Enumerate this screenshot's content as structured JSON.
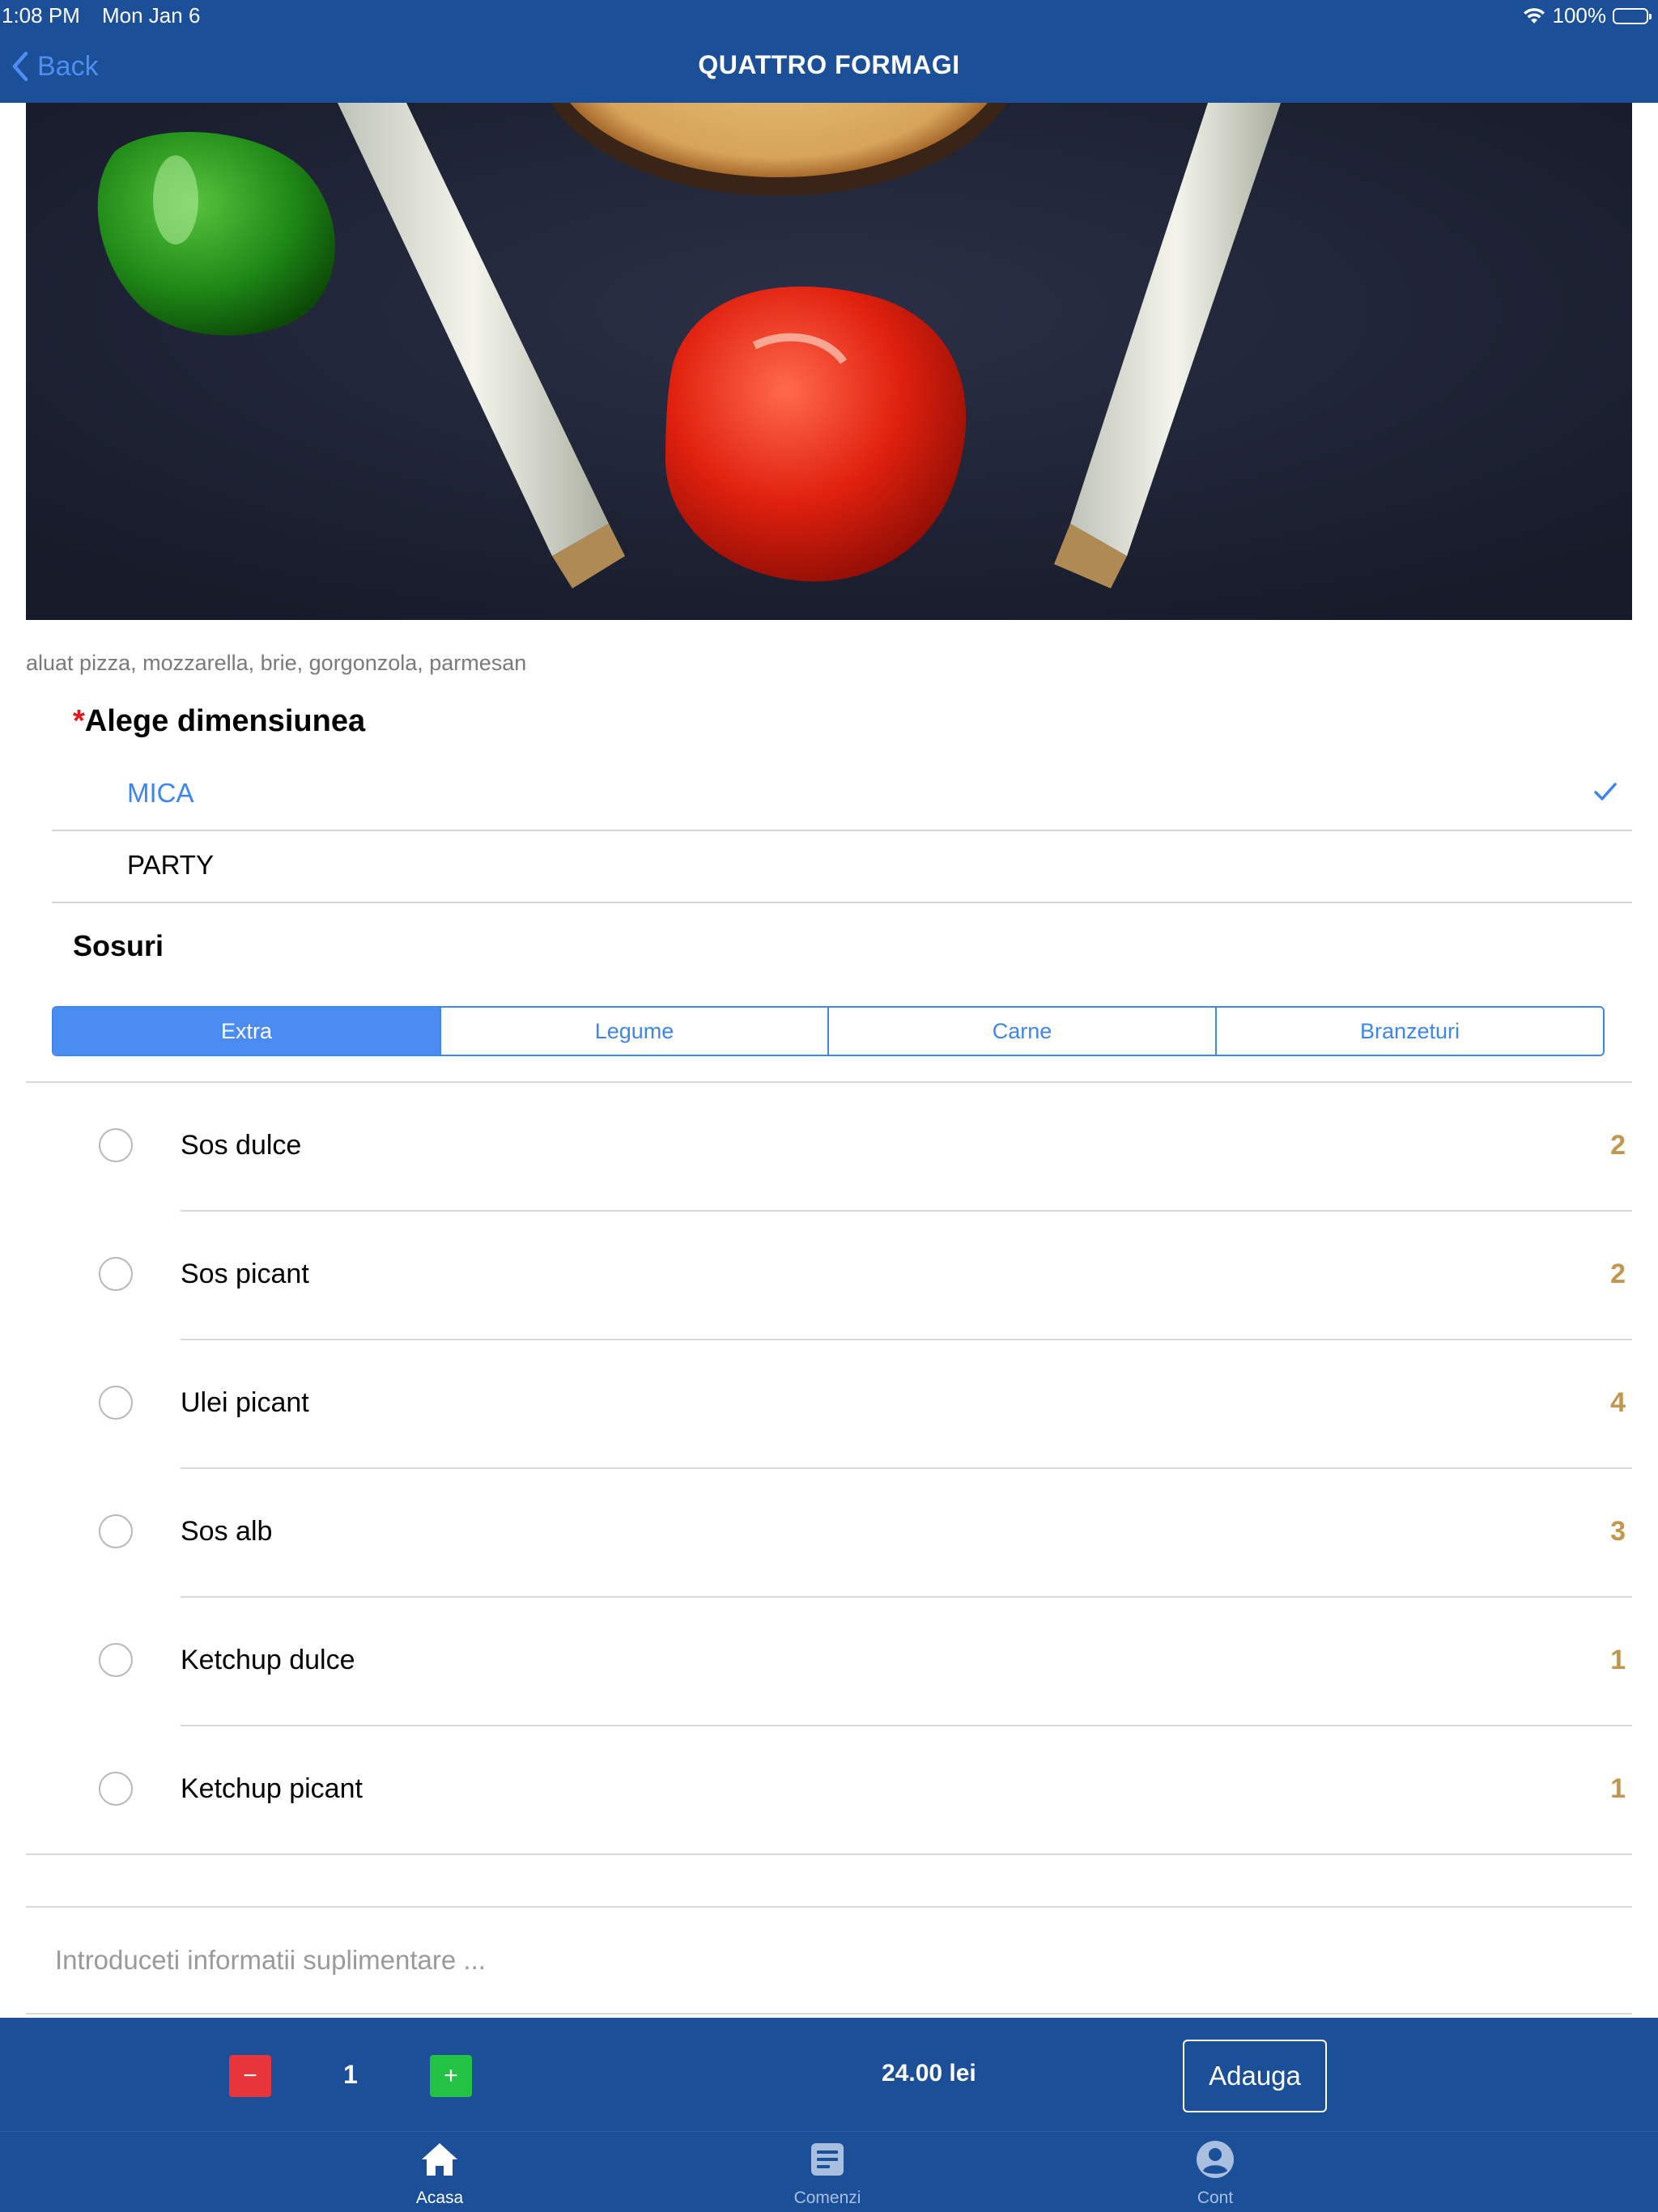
{
  "status_bar": {
    "time": "1:08 PM",
    "date": "Mon Jan 6",
    "battery": "100%"
  },
  "nav": {
    "back_label": "Back",
    "title": "QUATTRO FORMAGI"
  },
  "product": {
    "ingredients": "aluat pizza, mozzarella, brie, gorgonzola, parmesan"
  },
  "size_section": {
    "required_mark": "*",
    "title": "Alege dimensiunea",
    "options": [
      {
        "label": "MICA",
        "selected": true
      },
      {
        "label": "PARTY",
        "selected": false
      }
    ]
  },
  "sauces_section": {
    "title": "Sosuri",
    "tabs": [
      {
        "label": "Extra",
        "active": true
      },
      {
        "label": "Legume",
        "active": false
      },
      {
        "label": "Carne",
        "active": false
      },
      {
        "label": "Branzeturi",
        "active": false
      }
    ],
    "items": [
      {
        "name": "Sos dulce",
        "price": "2"
      },
      {
        "name": "Sos picant",
        "price": "2"
      },
      {
        "name": "Ulei picant",
        "price": "4"
      },
      {
        "name": "Sos alb",
        "price": "3"
      },
      {
        "name": "Ketchup dulce",
        "price": "1"
      },
      {
        "name": "Ketchup picant",
        "price": "1"
      }
    ]
  },
  "notes": {
    "placeholder": "Introduceti informatii suplimentare ...",
    "value": ""
  },
  "order_bar": {
    "minus": "−",
    "quantity": "1",
    "plus": "+",
    "total": "24.00 lei",
    "add_label": "Adauga"
  },
  "tab_bar": {
    "items": [
      {
        "label": "Acasa",
        "icon": "home-icon",
        "active": true
      },
      {
        "label": "Comenzi",
        "icon": "orders-icon",
        "active": false
      },
      {
        "label": "Cont",
        "icon": "account-icon",
        "active": false
      }
    ]
  },
  "colors": {
    "brand_blue": "#1b4f98",
    "accent_blue": "#3f86ea",
    "price_gold": "#c3964e",
    "minus_red": "#e8343b",
    "plus_green": "#23c244",
    "required_red": "#e0181e"
  }
}
